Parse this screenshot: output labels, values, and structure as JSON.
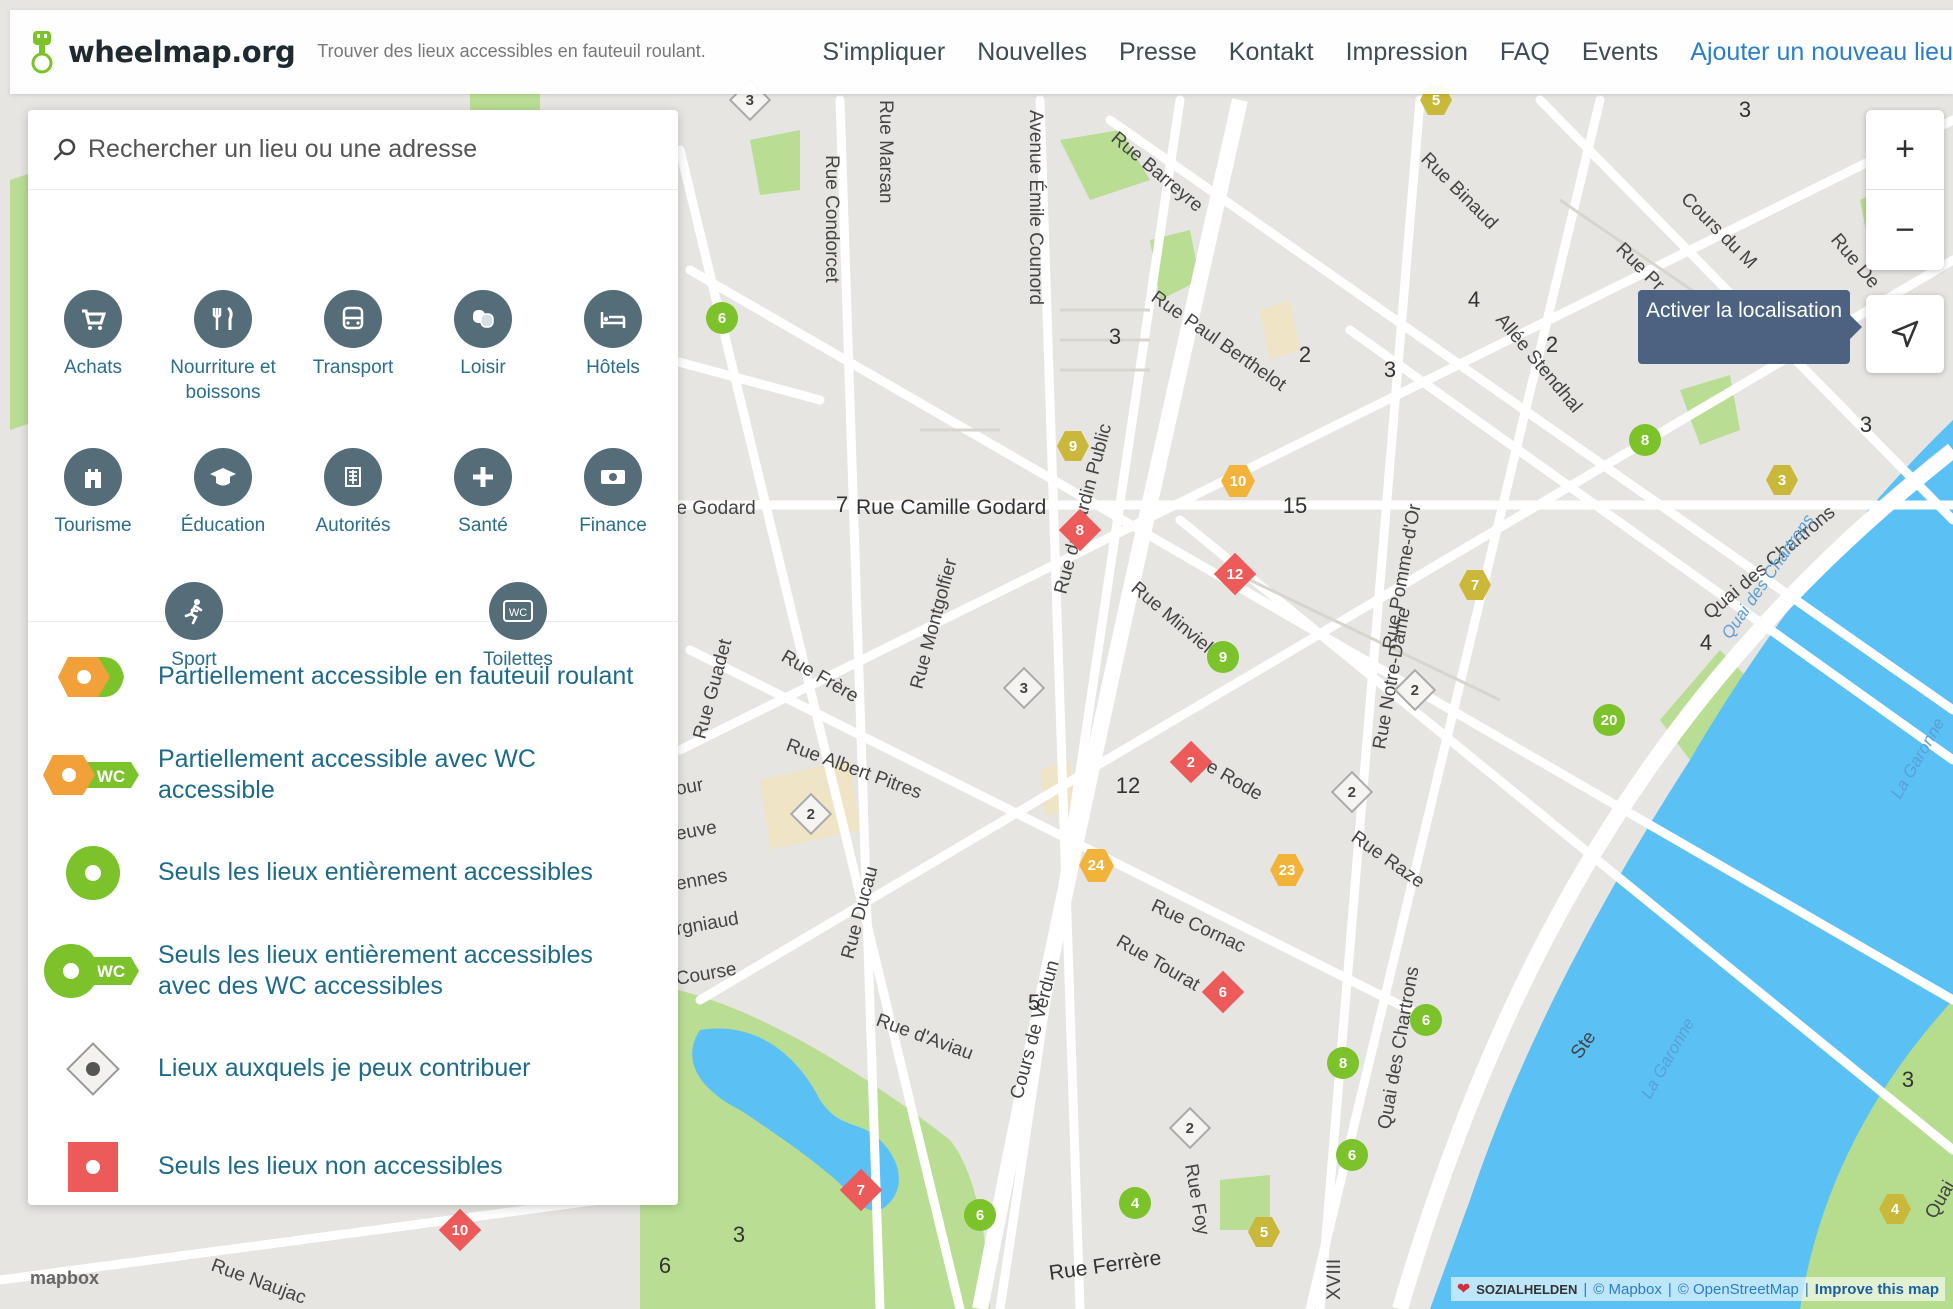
{
  "header": {
    "logo_text": "wheelmap.org",
    "tagline": "Trouver des lieux accessibles en fauteuil roulant.",
    "nav": [
      "S'impliquer",
      "Nouvelles",
      "Presse",
      "Kontakt",
      "Impression",
      "FAQ",
      "Events"
    ],
    "nav_accent": "Ajouter un nouveau lieu"
  },
  "search": {
    "placeholder": "Rechercher un lieu ou une adresse"
  },
  "categories": [
    {
      "label": "Achats",
      "icon": "cart-icon"
    },
    {
      "label": "Nourriture et boissons",
      "icon": "fork-knife-icon"
    },
    {
      "label": "Transport",
      "icon": "bus-icon"
    },
    {
      "label": "Loisir",
      "icon": "theater-masks-icon"
    },
    {
      "label": "Hôtels",
      "icon": "bed-icon"
    },
    {
      "label": "Tourisme",
      "icon": "castle-icon"
    },
    {
      "label": "Éducation",
      "icon": "graduation-cap-icon"
    },
    {
      "label": "Autorités",
      "icon": "building-icon"
    },
    {
      "label": "Santé",
      "icon": "plus-icon"
    },
    {
      "label": "Finance",
      "icon": "banknote-icon"
    },
    {
      "label": "Sport",
      "icon": "runner-icon"
    },
    {
      "label": "Toilettes",
      "icon": "wc-icon"
    }
  ],
  "legend": [
    {
      "label": "Partiellement accessible en fauteuil roulant",
      "icon": "partial-accessible-icon"
    },
    {
      "label": "Partiellement accessible avec WC accessible",
      "icon": "partial-wc-icon"
    },
    {
      "label": "Seuls les lieux entièrement accessibles",
      "icon": "full-accessible-icon"
    },
    {
      "label": "Seuls les lieux entièrement accessibles avec des WC accessibles",
      "icon": "full-wc-icon"
    },
    {
      "label": "Lieux auxquels je peux contribuer",
      "icon": "contribute-icon"
    },
    {
      "label": "Seuls les lieux non accessibles",
      "icon": "not-accessible-icon"
    }
  ],
  "controls": {
    "zoom_in": "+",
    "zoom_out": "−",
    "locate_tooltip": "Activer la localisation"
  },
  "map": {
    "streets": [
      "Rue Camille Godard",
      "lle Godard",
      "Rue Condorcet",
      "Rue Marsan",
      "Avenue Émile Counord",
      "Rue Barreyre",
      "Rue Paul Berthelot",
      "Rue Binaud",
      "Allée Stendhal",
      "Cours du M",
      "Rue Pr",
      "Rue De",
      "Rue du Jardin Public",
      "Rue Minvielle",
      "Rue Pomme-d'Or",
      "Rue Notre-Dame",
      "Quai des Chartrons",
      "Rue Frère",
      "Rue Montgolfier",
      "Rue Guadet",
      "Rue Albert Pitres",
      "e Rode",
      "Rue Raze",
      "Rue Cornac",
      "Rue Tourat",
      "Rue Ducau",
      "Rue d'Aviau",
      "Cours de Verdun",
      "Quai des Chartrons",
      "Rue Foy",
      "Rue Ferrère",
      "Rue Naujac",
      "Course",
      "rgniaud",
      "ennes",
      "euve",
      "our",
      "Quai des Chartrons",
      "La Garonne",
      "La Garonne",
      "Ste",
      "Quai",
      "XVIII"
    ],
    "marker_numbers": [
      "3",
      "5",
      "3",
      "6",
      "4",
      "2",
      "3",
      "2",
      "3",
      "8",
      "3",
      "3",
      "9",
      "10",
      "15",
      "7",
      "8",
      "12",
      "7",
      "9",
      "4",
      "2",
      "20",
      "3",
      "2",
      "12",
      "24",
      "2",
      "24",
      "23",
      "2",
      "6",
      "5",
      "6",
      "8",
      "2",
      "6",
      "6",
      "4",
      "5",
      "10",
      "3",
      "6",
      "7",
      "3",
      "4"
    ]
  },
  "attribution": {
    "mapbox_logo": "mapbox",
    "sozialhelden": "SOZIALHELDEN",
    "mapbox": "© Mapbox",
    "osm": "© OpenStreetMap",
    "improve": "Improve this map"
  },
  "colors": {
    "partial": "#f2a03a",
    "full": "#7cc22a",
    "not_accessible": "#ec5a5a",
    "water": "#5bc1f5",
    "park": "#b6dd8e",
    "accent": "#2a7ecb",
    "category": "#556d78"
  }
}
